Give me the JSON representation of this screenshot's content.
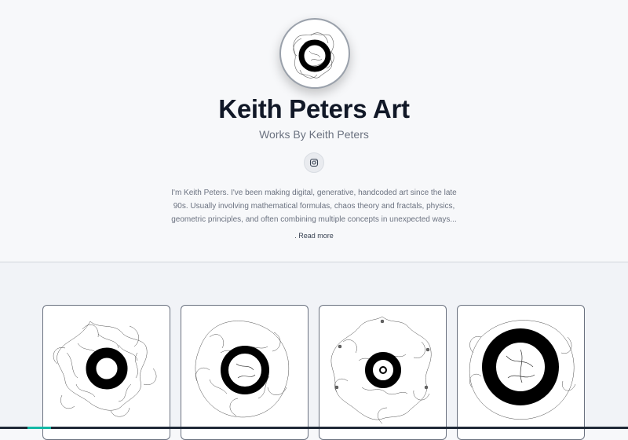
{
  "profile": {
    "title": "Keith Peters Art",
    "subtitle": "Works By Keith Peters",
    "avatar_icon": "generative-art-avatar",
    "social_icon": "instagram-icon",
    "bio": "I'm Keith Peters. I've been making digital, generative, handcoded art since the late 90s. Usually involving mathematical formulas, chaos theory and fractals, physics, geometric principles, and often combining multiple concepts in unexpected ways...",
    "read_more": ". Read more"
  },
  "gallery": {
    "items": [
      {
        "icon": "generative-art-thumbnail"
      },
      {
        "icon": "generative-art-thumbnail"
      },
      {
        "icon": "generative-art-thumbnail"
      },
      {
        "icon": "generative-art-thumbnail"
      }
    ]
  },
  "colors": {
    "background": "#f7f8fa",
    "title": "#111827",
    "muted_text": "#6b7280",
    "accent": "#14b8a6"
  }
}
